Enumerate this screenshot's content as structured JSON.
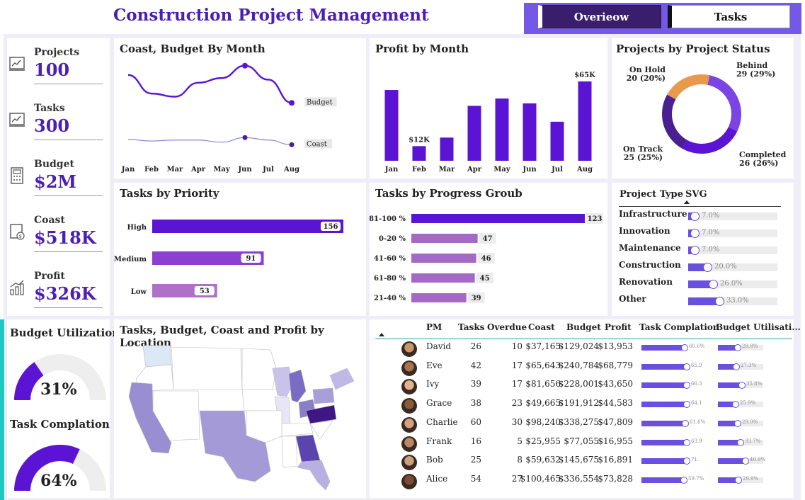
{
  "header": {
    "title": "Construction Project Management",
    "nav": [
      {
        "label": "Overieow"
      },
      {
        "label": "Tasks"
      }
    ]
  },
  "colors": {
    "accent": "#4b1fb1",
    "primary": "#5b14d4",
    "nav": "#7458e8",
    "nav_active": "#3b1d6e",
    "teal": "#1ec8c0"
  },
  "kpis": [
    {
      "label": "Projects",
      "value": "100",
      "icon": "chart-doc-icon"
    },
    {
      "label": "Tasks",
      "value": "300",
      "icon": "chart-doc-icon"
    },
    {
      "label": "Budget",
      "value": "$2M",
      "icon": "calculator-icon"
    },
    {
      "label": "Coast",
      "value": "$518K",
      "icon": "money-doc-icon"
    },
    {
      "label": "Profit",
      "value": "$326K",
      "icon": "growth-icon"
    }
  ],
  "gauges": [
    {
      "label": "Budget Utilization",
      "value": "31%",
      "fraction": 0.31
    },
    {
      "label": "Task Complation",
      "value": "64%",
      "fraction": 0.64
    }
  ],
  "project_type": {
    "header": "Project Type",
    "filter": "SVG",
    "rows": [
      {
        "name": "Infrastructure",
        "pct": "7.0%",
        "value": 0.07
      },
      {
        "name": "Innovation",
        "pct": "7.0%",
        "value": 0.07
      },
      {
        "name": "Maintenance",
        "pct": "7.0%",
        "value": 0.07
      },
      {
        "name": "Construction",
        "pct": "20.0%",
        "value": 0.2
      },
      {
        "name": "Renovation",
        "pct": "26.0%",
        "value": 0.26
      },
      {
        "name": "Other",
        "pct": "33.0%",
        "value": 0.33
      }
    ]
  },
  "map": {
    "title": "Tasks, Budget, Coast and Profit by Location"
  },
  "table": {
    "headers": [
      "PM",
      "Tasks",
      "Overdue",
      "Coast",
      "Budget",
      "Profit",
      "Task Complation",
      "Budget Utilisati..."
    ],
    "rows": [
      {
        "pm": "David",
        "tasks": "26",
        "overdue": "10",
        "coast": "$37,165",
        "budget": "$129,024",
        "profit": "$13,953",
        "tc": "60.6%",
        "tcv": 0.606,
        "bu": "28.8%",
        "buv": 0.288
      },
      {
        "pm": "Eve",
        "tasks": "42",
        "overdue": "17",
        "coast": "$65,643",
        "budget": "$240,784",
        "profit": "$68,779",
        "tc": "65.9",
        "tcv": 0.659,
        "bu": "27.3%",
        "buv": 0.273
      },
      {
        "pm": "Ivy",
        "tasks": "39",
        "overdue": "17",
        "coast": "$81,656",
        "budget": "$228,001",
        "profit": "$43,650",
        "tc": "66.3",
        "tcv": 0.663,
        "bu": "35.8%",
        "buv": 0.358
      },
      {
        "pm": "Grace",
        "tasks": "38",
        "overdue": "23",
        "coast": "$49,665",
        "budget": "$191,912",
        "profit": "$44,583",
        "tc": "64.1",
        "tcv": 0.641,
        "bu": "25.9%",
        "buv": 0.259
      },
      {
        "pm": "Charlie",
        "tasks": "60",
        "overdue": "30",
        "coast": "$98,240",
        "budget": "$338,275",
        "profit": "$47,809",
        "tc": "61.6%",
        "tcv": 0.616,
        "bu": "29.0%",
        "buv": 0.29
      },
      {
        "pm": "Frank",
        "tasks": "16",
        "overdue": "5",
        "coast": "$25,955",
        "budget": "$77,055",
        "profit": "$16,955",
        "tc": "63.9",
        "tcv": 0.639,
        "bu": "33.7%",
        "buv": 0.337
      },
      {
        "pm": "Bob",
        "tasks": "25",
        "overdue": "8",
        "coast": "$59,632",
        "budget": "$145,675",
        "profit": "$16,891",
        "tc": "71.",
        "tcv": 0.71,
        "bu": "40.9%",
        "buv": 0.409
      },
      {
        "pm": "Alice",
        "tasks": "54",
        "overdue": "27",
        "coast": "$100,465",
        "budget": "$336,554",
        "profit": "$73,828",
        "tc": "59.7%",
        "tcv": 0.597,
        "bu": "29.9%",
        "buv": 0.299
      }
    ]
  },
  "chart_data": [
    {
      "type": "line",
      "title": "Coast, Budget By Month",
      "categories": [
        "Jan",
        "Feb",
        "Mar",
        "Apr",
        "May",
        "Jun",
        "Jul",
        "Aug"
      ],
      "series": [
        {
          "name": "Budget",
          "values": [
            270,
            210,
            200,
            245,
            260,
            300,
            255,
            180
          ]
        },
        {
          "name": "Coast",
          "values": [
            62,
            57,
            60,
            60,
            53,
            68,
            60,
            45
          ]
        }
      ],
      "ylim": [
        0,
        320
      ]
    },
    {
      "type": "bar",
      "title": "Profit by Month",
      "categories": [
        "Jan",
        "Feb",
        "Mar",
        "Apr",
        "May",
        "Jun",
        "Jul",
        "Aug"
      ],
      "values": [
        58,
        12,
        19,
        45,
        51,
        47,
        32,
        65
      ],
      "data_labels": {
        "Feb": "$12K",
        "Aug": "$65K"
      },
      "ylim": [
        0,
        65
      ]
    },
    {
      "type": "pie",
      "title": "Projects by Project Status",
      "slices": [
        {
          "name": "Behind",
          "value": 29,
          "pct": "29%",
          "label": "29 (29%)",
          "color": "#7a45e3"
        },
        {
          "name": "Completed",
          "value": 26,
          "pct": "26%",
          "label": "26 (26%)",
          "color": "#5b14d4"
        },
        {
          "name": "On Track",
          "value": 25,
          "pct": "25%",
          "label": "25 (25%)",
          "color": "#4a1f8f"
        },
        {
          "name": "On Hold",
          "value": 20,
          "pct": "20%",
          "label": "20 (20%)",
          "color": "#e8994c"
        }
      ]
    },
    {
      "type": "bar",
      "orientation": "horizontal",
      "title": "Tasks by Priority",
      "categories": [
        "High",
        "Medium",
        "Low"
      ],
      "values": [
        156,
        91,
        53
      ],
      "colors": [
        "#5b14d4",
        "#8c3fd0",
        "#b070c8"
      ]
    },
    {
      "type": "bar",
      "orientation": "horizontal",
      "title": "Tasks by Progress Groub",
      "categories": [
        "81-100 %",
        "0-20 %",
        "41-60 %",
        "61-80 %",
        "21-40 %"
      ],
      "values": [
        123,
        47,
        46,
        45,
        39
      ],
      "colors": [
        "#5b14d4",
        "#a369c4",
        "#a369c4",
        "#a369c4",
        "#a369c4"
      ]
    }
  ]
}
